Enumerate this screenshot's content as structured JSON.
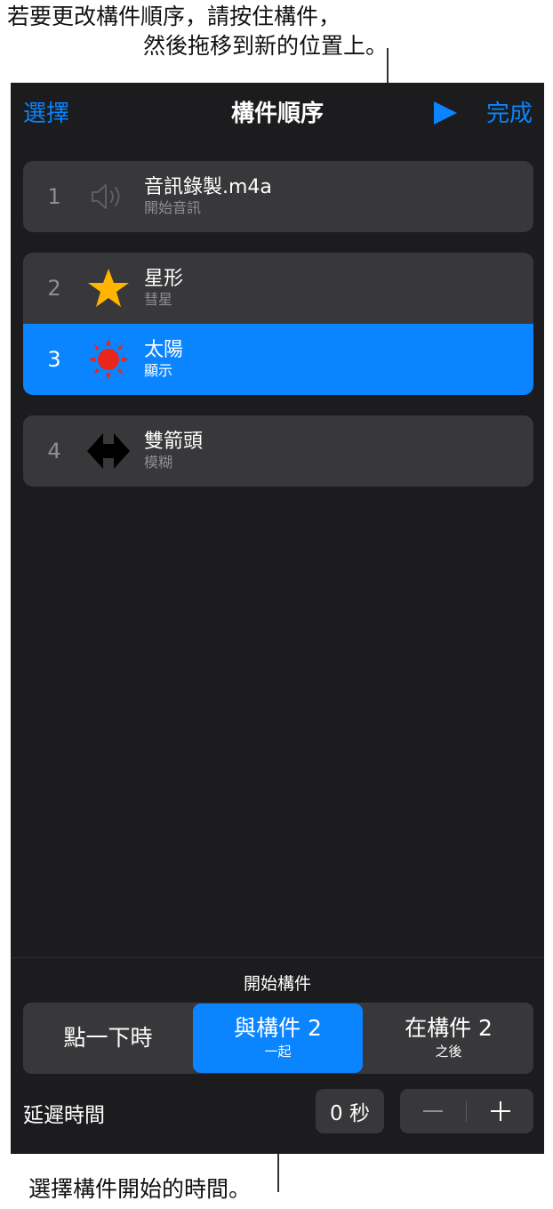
{
  "callouts": {
    "top_line1": "若要更改構件順序，請按住構件，",
    "top_line2": "然後拖移到新的位置上。",
    "bottom": "選擇構件開始的時間。"
  },
  "nav": {
    "select_label": "選擇",
    "title": "構件順序",
    "play_icon": "play-icon",
    "done_label": "完成"
  },
  "builds": [
    {
      "number": "1",
      "icon": "speaker-icon",
      "name": "音訊錄製.m4a",
      "effect": "開始音訊"
    },
    {
      "number": "2",
      "icon": "star-icon",
      "name": "星形",
      "effect": "彗星"
    },
    {
      "number": "3",
      "icon": "sun-icon",
      "name": "太陽",
      "effect": "顯示",
      "selected": true
    },
    {
      "number": "4",
      "icon": "double-arrow-icon",
      "name": "雙箭頭",
      "effect": "模糊"
    }
  ],
  "start_build": {
    "heading": "開始構件",
    "options": [
      {
        "main": "點一下時",
        "sub": ""
      },
      {
        "main": "與構件 2",
        "sub": "一起",
        "active": true
      },
      {
        "main": "在構件 2",
        "sub": "之後"
      }
    ]
  },
  "delay": {
    "label": "延遲時間",
    "value": "0 秒",
    "minus": "−",
    "plus": "+"
  },
  "colors": {
    "accent": "#0a84ff",
    "panel_bg": "#1c1c1e",
    "row_bg": "#38383a",
    "star": "#ffb400",
    "sun": "#e8261c"
  }
}
